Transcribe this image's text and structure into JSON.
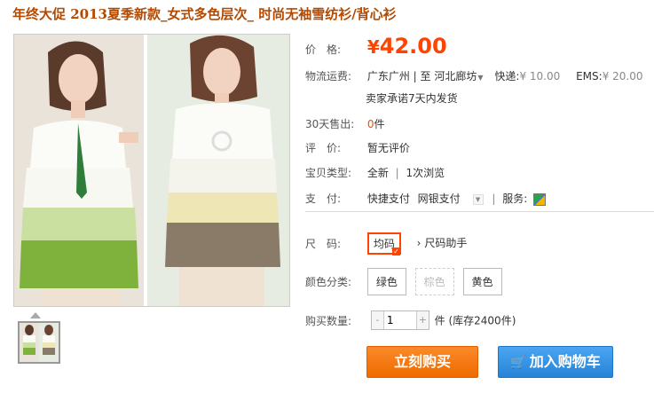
{
  "product": {
    "title": "年终大促 2013夏季新款_女式多色层次_ 时尚无袖雪纺衫/背心衫"
  },
  "price": {
    "label": "价　格:",
    "currency": "¥",
    "value": "42.00"
  },
  "shipping": {
    "label": "物流运费:",
    "origin": "广东广州",
    "sep": "|",
    "to_word": "至",
    "destination": "河北廊坊",
    "express_label": "快递:",
    "express_price": "¥ 10.00",
    "ems_label": "EMS:",
    "ems_price": "¥ 20.00",
    "promise": "卖家承诺7天内发货"
  },
  "sales": {
    "label": "30天售出:",
    "count": "0",
    "unit": "件"
  },
  "review": {
    "label": "评　价:",
    "value": "暂无评价"
  },
  "condition": {
    "label": "宝贝类型:",
    "value": "全新",
    "sep": "|",
    "views": "1次浏览"
  },
  "payment": {
    "label": "支　付:",
    "method1": "快捷支付",
    "method2": "网银支付",
    "service_label": "服务:",
    "service_icon": "service-badge-icon"
  },
  "size": {
    "label": "尺　码:",
    "selected": "均码",
    "helper": "尺码助手"
  },
  "color": {
    "label": "颜色分类:",
    "options": [
      "绿色",
      "棕色",
      "黄色"
    ]
  },
  "quantity": {
    "label": "购买数量:",
    "minus": "-",
    "plus": "+",
    "value": "1",
    "stock_text": "件 (库存2400件)"
  },
  "actions": {
    "buy_now": "立刻购买",
    "add_to_cart": "加入购物车",
    "cart_icon": "cart-icon"
  },
  "colors": {
    "accent_orange": "#ff4400",
    "buy_button": "#f47a14",
    "cart_button": "#3993e3",
    "title_color": "#b34a00"
  }
}
